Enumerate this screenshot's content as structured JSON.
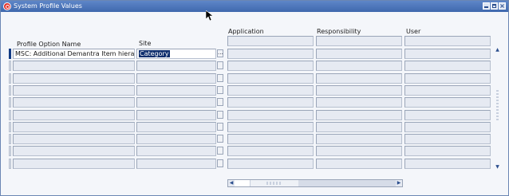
{
  "window": {
    "title": "System Profile Values"
  },
  "columns": {
    "profile_option_name": "Profile Option Name",
    "site": "Site",
    "application": "Application",
    "responsibility": "Responsibility",
    "user": "User"
  },
  "rows": [
    {
      "profile_option_name": "MSC: Additional Demantra Item hierarch",
      "site": "Category",
      "application": "",
      "responsibility": "",
      "user": ""
    },
    {
      "profile_option_name": "",
      "site": "",
      "application": "",
      "responsibility": "",
      "user": ""
    },
    {
      "profile_option_name": "",
      "site": "",
      "application": "",
      "responsibility": "",
      "user": ""
    },
    {
      "profile_option_name": "",
      "site": "",
      "application": "",
      "responsibility": "",
      "user": ""
    },
    {
      "profile_option_name": "",
      "site": "",
      "application": "",
      "responsibility": "",
      "user": ""
    },
    {
      "profile_option_name": "",
      "site": "",
      "application": "",
      "responsibility": "",
      "user": ""
    },
    {
      "profile_option_name": "",
      "site": "",
      "application": "",
      "responsibility": "",
      "user": ""
    },
    {
      "profile_option_name": "",
      "site": "",
      "application": "",
      "responsibility": "",
      "user": ""
    },
    {
      "profile_option_name": "",
      "site": "",
      "application": "",
      "responsibility": "",
      "user": ""
    },
    {
      "profile_option_name": "",
      "site": "",
      "application": "",
      "responsibility": "",
      "user": ""
    }
  ],
  "lov_button": "...",
  "icons": {
    "app": "oracle-icon",
    "minimize": "minimize-icon",
    "maximize": "maximize-icon",
    "close": "close-icon",
    "cursor": "mouse-pointer-icon",
    "scroll_up": "arrow-up-icon",
    "scroll_down": "arrow-down-icon",
    "scroll_left": "arrow-left-icon",
    "scroll_right": "arrow-right-icon"
  },
  "colors": {
    "titlebar": "#4a74b8",
    "selection": "#0f2f6e",
    "current_record": "#123b84",
    "oracle_red": "#e3322b"
  }
}
